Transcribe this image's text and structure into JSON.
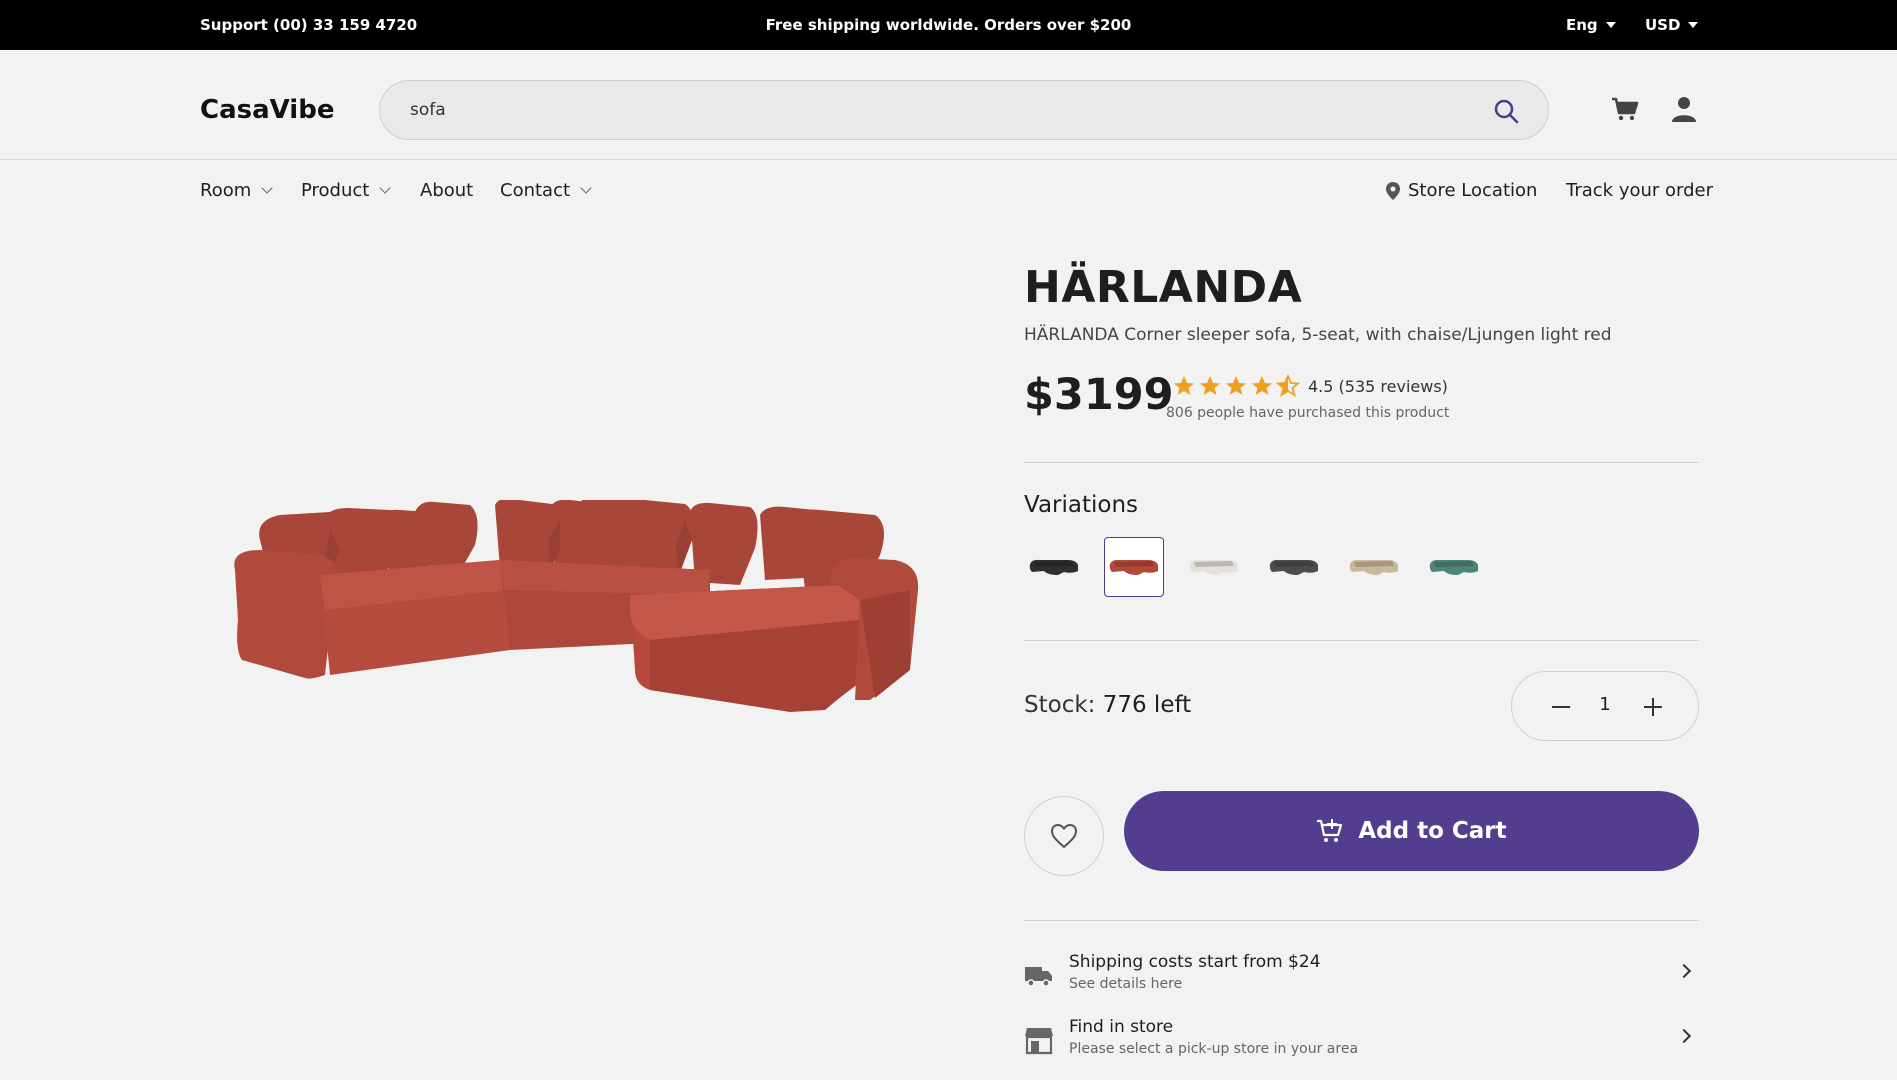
{
  "topbar": {
    "support": "Support (00) 33 159 4720",
    "promo": "Free shipping worldwide. Orders over $200",
    "language": "Eng",
    "currency": "USD"
  },
  "header": {
    "logo": "CasaVibe",
    "search_value": "sofa"
  },
  "nav": {
    "room": "Room",
    "product": "Product",
    "about": "About",
    "contact": "Contact",
    "store_location": "Store Location",
    "track_order": "Track your order"
  },
  "product": {
    "name": "HÄRLANDA",
    "description": "HÄRLANDA Corner sleeper sofa, 5-seat, with chaise/Ljungen light red",
    "price": "$3199",
    "rating": 4.5,
    "rating_text": "4.5 (535 reviews)",
    "purchased_text": "806 people have purchased this product",
    "variations_label": "Variations",
    "variations": [
      {
        "color": "#2f2f31",
        "selected": false
      },
      {
        "color": "#b4483a",
        "selected": true
      },
      {
        "color": "#e4e1da",
        "selected": false
      },
      {
        "color": "#4b4d4f",
        "selected": false
      },
      {
        "color": "#c9b89c",
        "selected": false
      },
      {
        "color": "#4e8579",
        "selected": false
      }
    ],
    "stock_label": "Stock:",
    "stock_value": "776 left",
    "quantity": "1",
    "add_to_cart": "Add to Cart"
  },
  "info": {
    "shipping_title": "Shipping costs start from $24",
    "shipping_sub": "See details here",
    "store_title": "Find in store",
    "store_sub": "Please select a pick-up store in your area"
  },
  "colors": {
    "accent": "#533d8f",
    "star": "#f0a020",
    "sofa": "#b4483a"
  }
}
